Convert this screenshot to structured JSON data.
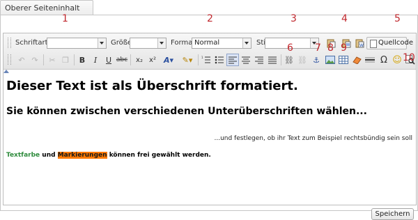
{
  "tab": {
    "title": "Oberer Seiteninhalt"
  },
  "toolbar": {
    "font_label": "Schriftart",
    "font_value": "",
    "size_label": "Größe",
    "size_value": "",
    "format_label": "Format",
    "format_value": "Normal",
    "style_label": "Stil",
    "style_value": "",
    "source_label": "Quellcode",
    "omega_label": "Ω",
    "colors": {
      "accent_active": "#dbe4f5",
      "annotation": "#c0272d"
    }
  },
  "annotations": [
    "1",
    "2",
    "3",
    "4",
    "5",
    "6",
    "7",
    "8",
    "9",
    "10"
  ],
  "content": {
    "heading1": "Dieser Text ist als Überschrift formatiert.",
    "heading2": "Sie können zwischen verschiedenen Unterüberschriften wählen...",
    "right_text": "...und festlegen, ob ihr Text zum Beispiel rechtsbündig sein soll",
    "para_green": "Textfarbe",
    "para_and": "und",
    "para_highlight": "Markierungen",
    "para_rest": "können frei gewählt werden.",
    "colors": {
      "green": "#2e8b3c",
      "highlight": "#ff7a00"
    }
  },
  "save_button": "Speichern"
}
